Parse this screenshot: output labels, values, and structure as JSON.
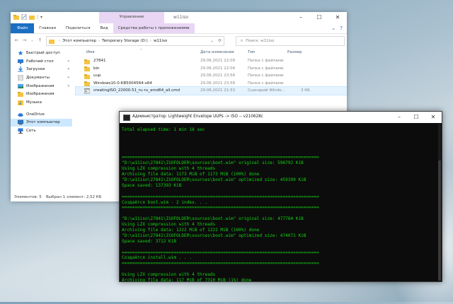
{
  "explorer": {
    "title": "w11iso",
    "manage_label": "Управление",
    "tabs": [
      "Файл",
      "Главная",
      "Поделиться",
      "Вид",
      "Средства работы с приложениями"
    ],
    "address": [
      "Этот компьютер",
      "Temporary Storage (D:)",
      "w11iso"
    ],
    "search_placeholder": "Поиск: w11iso",
    "columns": {
      "name": "Имя",
      "date": "Дата изменения",
      "type": "Тип",
      "size": "Размер"
    },
    "sidebar": [
      {
        "label": "Быстрый доступ",
        "icon": "star-icon",
        "pinned": false
      },
      {
        "label": "Рабочий стол",
        "icon": "desktop-icon",
        "pinned": true
      },
      {
        "label": "Загрузки",
        "icon": "download-icon",
        "pinned": true
      },
      {
        "label": "Документы",
        "icon": "document-icon",
        "pinned": true
      },
      {
        "label": "Изображения",
        "icon": "image-icon",
        "pinned": true
      },
      {
        "label": "Изображения",
        "icon": "folder-icon",
        "pinned": false
      },
      {
        "label": "Музыка",
        "icon": "music-icon",
        "pinned": false
      },
      {
        "label": "OneDrive",
        "icon": "cloud-icon",
        "pinned": false
      },
      {
        "label": "Этот компьютер",
        "icon": "computer-icon",
        "pinned": false
      },
      {
        "label": "Сеть",
        "icon": "network-icon",
        "pinned": false
      }
    ],
    "files": [
      {
        "name": "27841",
        "date": "29.06.2021 22:09",
        "type": "Папка с файлами",
        "size": "",
        "kind": "folder"
      },
      {
        "name": "bin",
        "date": "29.06.2021 22:04",
        "type": "Папка с файлами",
        "size": "",
        "kind": "folder"
      },
      {
        "name": "uup",
        "date": "29.06.2021 23:56",
        "type": "Папка с файлами",
        "size": "",
        "kind": "folder"
      },
      {
        "name": "Windows10.0-KB5004564-x64",
        "date": "29.06.2021 23:58",
        "type": "Папка с файлами",
        "size": "",
        "kind": "folder"
      },
      {
        "name": "creatingISO_22000.51_ru-ru_amd64_all.cmd",
        "date": "29.06.2021 21:53",
        "type": "Сценарий Windo...",
        "size": "3 КБ",
        "kind": "script"
      }
    ],
    "status": {
      "count": "Элементов: 5",
      "selected": "Выбран 1 элемент: 2,52 КБ"
    }
  },
  "console": {
    "title": "Администратор:  Lightweight Envelope UUPs -> ISO -- v210628c",
    "lines": [
      "Total elapsed time: 1 min 18 sec",
      "",
      "",
      "",
      "",
      "============================================================================",
      "\"D:\\w11iso\\27841\\ISOFOLDER\\sources\\boot.wim\" original size: 596792 KiB",
      "Using LZX compression with 4 threads",
      "Archiving file data: 1173 MiB of 1173 MiB (100%) done",
      "\"D:\\w11iso\\27841\\ISOFOLDER\\sources\\boot.wim\" optimized size: 459399 KiB",
      "Space saved: 137393 KiB",
      "",
      "============================================================================",
      "Создаётся boot.wim - 2 index. . .",
      "============================================================================",
      "",
      "\"D:\\w11iso\\27841\\ISOFOLDER\\sources\\boot.wim\" original size: 477784 KiB",
      "Using LZX compression with 4 threads",
      "Archiving file data: 1222 MiB of 1222 MiB (100%) done",
      "\"D:\\w11iso\\27841\\ISOFOLDER\\sources\\boot.wim\" optimized size: 474071 KiB",
      "Space saved: 3712 KiB",
      "",
      "============================================================================",
      "Создаётся install.wim . . .",
      "============================================================================",
      "",
      "Using LZX compression with 4 threads",
      "Archiving file data: 117 MiB of 7310 MiB (1%) done"
    ]
  },
  "colors": {
    "console_text": "#13d413",
    "accent": "#1a6fc3",
    "manage_tab": "#e8d6f4",
    "selection": "#cce8ff"
  }
}
